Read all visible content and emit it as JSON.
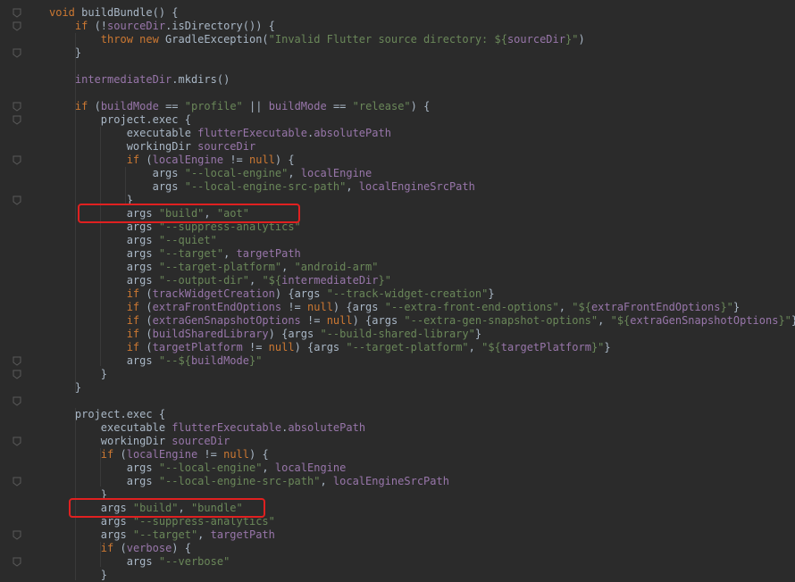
{
  "editor": {
    "language": "groovy",
    "colors": {
      "background": "#2b2b2b",
      "keyword": "#cc7832",
      "string": "#6a8759",
      "field": "#9876aa",
      "plain": "#a9b7c6",
      "highlight": "#e02020"
    },
    "highlights": [
      {
        "label": "args build aot",
        "line_index": 15
      },
      {
        "label": "args build bundle",
        "line_index": 37
      }
    ],
    "lines": [
      [
        [
          "kw",
          "void "
        ],
        [
          "plain",
          "buildBundle() {"
        ]
      ],
      [
        [
          "kw",
          "    if "
        ],
        [
          "plain",
          "(!"
        ],
        [
          "fld",
          "sourceDir"
        ],
        [
          "plain",
          ".isDirectory()) {"
        ]
      ],
      [
        [
          "kw",
          "        throw new "
        ],
        [
          "plain",
          "GradleException("
        ],
        [
          "str",
          "\"Invalid Flutter source directory: ${"
        ],
        [
          "fld",
          "sourceDir"
        ],
        [
          "str",
          "}\""
        ],
        [
          "plain",
          ")"
        ]
      ],
      [
        [
          "plain",
          "    }"
        ]
      ],
      [
        [
          "plain",
          ""
        ]
      ],
      [
        [
          "plain",
          "    "
        ],
        [
          "fld",
          "intermediateDir"
        ],
        [
          "plain",
          ".mkdirs()"
        ]
      ],
      [
        [
          "plain",
          ""
        ]
      ],
      [
        [
          "kw",
          "    if "
        ],
        [
          "plain",
          "("
        ],
        [
          "fld",
          "buildMode "
        ],
        [
          "plain",
          "== "
        ],
        [
          "str",
          "\"profile\" "
        ],
        [
          "plain",
          "|| "
        ],
        [
          "fld",
          "buildMode "
        ],
        [
          "plain",
          "== "
        ],
        [
          "str",
          "\"release\""
        ],
        [
          "plain",
          ") {"
        ]
      ],
      [
        [
          "plain",
          "        project.exec {"
        ]
      ],
      [
        [
          "plain",
          "            executable "
        ],
        [
          "fld",
          "flutterExecutable"
        ],
        [
          "plain",
          "."
        ],
        [
          "fld",
          "absolutePath"
        ]
      ],
      [
        [
          "plain",
          "            workingDir "
        ],
        [
          "fld",
          "sourceDir"
        ]
      ],
      [
        [
          "kw",
          "            if "
        ],
        [
          "plain",
          "("
        ],
        [
          "fld",
          "localEngine "
        ],
        [
          "plain",
          "!= "
        ],
        [
          "kw",
          "null"
        ],
        [
          "plain",
          ") {"
        ]
      ],
      [
        [
          "plain",
          "                args "
        ],
        [
          "str",
          "\"--local-engine\""
        ],
        [
          "plain",
          ", "
        ],
        [
          "fld",
          "localEngine"
        ]
      ],
      [
        [
          "plain",
          "                args "
        ],
        [
          "str",
          "\"--local-engine-src-path\""
        ],
        [
          "plain",
          ", "
        ],
        [
          "fld",
          "localEngineSrcPath"
        ]
      ],
      [
        [
          "plain",
          "            }"
        ]
      ],
      [
        [
          "plain",
          "            args "
        ],
        [
          "str",
          "\"build\""
        ],
        [
          "plain",
          ", "
        ],
        [
          "str",
          "\"aot\""
        ]
      ],
      [
        [
          "plain",
          "            args "
        ],
        [
          "str",
          "\"--suppress-analytics\""
        ]
      ],
      [
        [
          "plain",
          "            args "
        ],
        [
          "str",
          "\"--quiet\""
        ]
      ],
      [
        [
          "plain",
          "            args "
        ],
        [
          "str",
          "\"--target\""
        ],
        [
          "plain",
          ", "
        ],
        [
          "fld",
          "targetPath"
        ]
      ],
      [
        [
          "plain",
          "            args "
        ],
        [
          "str",
          "\"--target-platform\""
        ],
        [
          "plain",
          ", "
        ],
        [
          "str",
          "\"android-arm\""
        ]
      ],
      [
        [
          "plain",
          "            args "
        ],
        [
          "str",
          "\"--output-dir\""
        ],
        [
          "plain",
          ", "
        ],
        [
          "str",
          "\"${"
        ],
        [
          "fld",
          "intermediateDir"
        ],
        [
          "str",
          "}\""
        ]
      ],
      [
        [
          "kw",
          "            if "
        ],
        [
          "plain",
          "("
        ],
        [
          "fld",
          "trackWidgetCreation"
        ],
        [
          "plain",
          ") {args "
        ],
        [
          "str",
          "\"--track-widget-creation\""
        ],
        [
          "plain",
          "}"
        ]
      ],
      [
        [
          "kw",
          "            if "
        ],
        [
          "plain",
          "("
        ],
        [
          "fld",
          "extraFrontEndOptions "
        ],
        [
          "plain",
          "!= "
        ],
        [
          "kw",
          "null"
        ],
        [
          "plain",
          ") {args "
        ],
        [
          "str",
          "\"--extra-front-end-options\""
        ],
        [
          "plain",
          ", "
        ],
        [
          "str",
          "\"${"
        ],
        [
          "fld",
          "extraFrontEndOptions"
        ],
        [
          "str",
          "}\""
        ],
        [
          "plain",
          "}"
        ]
      ],
      [
        [
          "kw",
          "            if "
        ],
        [
          "plain",
          "("
        ],
        [
          "fld",
          "extraGenSnapshotOptions "
        ],
        [
          "plain",
          "!= "
        ],
        [
          "kw",
          "null"
        ],
        [
          "plain",
          ") {args "
        ],
        [
          "str",
          "\"--extra-gen-snapshot-options\""
        ],
        [
          "plain",
          ", "
        ],
        [
          "str",
          "\"${"
        ],
        [
          "fld",
          "extraGenSnapshotOptions"
        ],
        [
          "str",
          "}\""
        ],
        [
          "plain",
          "}"
        ]
      ],
      [
        [
          "kw",
          "            if "
        ],
        [
          "plain",
          "("
        ],
        [
          "fld",
          "buildSharedLibrary"
        ],
        [
          "plain",
          ") {args "
        ],
        [
          "str",
          "\"--build-shared-library\""
        ],
        [
          "plain",
          "}"
        ]
      ],
      [
        [
          "kw",
          "            if "
        ],
        [
          "plain",
          "("
        ],
        [
          "fld",
          "targetPlatform "
        ],
        [
          "plain",
          "!= "
        ],
        [
          "kw",
          "null"
        ],
        [
          "plain",
          ") {args "
        ],
        [
          "str",
          "\"--target-platform\""
        ],
        [
          "plain",
          ", "
        ],
        [
          "str",
          "\"${"
        ],
        [
          "fld",
          "targetPlatform"
        ],
        [
          "str",
          "}\""
        ],
        [
          "plain",
          "}"
        ]
      ],
      [
        [
          "plain",
          "            args "
        ],
        [
          "str",
          "\"--${"
        ],
        [
          "fld",
          "buildMode"
        ],
        [
          "str",
          "}\""
        ]
      ],
      [
        [
          "plain",
          "        }"
        ]
      ],
      [
        [
          "plain",
          "    }"
        ]
      ],
      [
        [
          "plain",
          ""
        ]
      ],
      [
        [
          "plain",
          "    project.exec {"
        ]
      ],
      [
        [
          "plain",
          "        executable "
        ],
        [
          "fld",
          "flutterExecutable"
        ],
        [
          "plain",
          "."
        ],
        [
          "fld",
          "absolutePath"
        ]
      ],
      [
        [
          "plain",
          "        workingDir "
        ],
        [
          "fld",
          "sourceDir"
        ]
      ],
      [
        [
          "kw",
          "        if "
        ],
        [
          "plain",
          "("
        ],
        [
          "fld",
          "localEngine "
        ],
        [
          "plain",
          "!= "
        ],
        [
          "kw",
          "null"
        ],
        [
          "plain",
          ") {"
        ]
      ],
      [
        [
          "plain",
          "            args "
        ],
        [
          "str",
          "\"--local-engine\""
        ],
        [
          "plain",
          ", "
        ],
        [
          "fld",
          "localEngine"
        ]
      ],
      [
        [
          "plain",
          "            args "
        ],
        [
          "str",
          "\"--local-engine-src-path\""
        ],
        [
          "plain",
          ", "
        ],
        [
          "fld",
          "localEngineSrcPath"
        ]
      ],
      [
        [
          "plain",
          "        }"
        ]
      ],
      [
        [
          "plain",
          "        args "
        ],
        [
          "str",
          "\"build\""
        ],
        [
          "plain",
          ", "
        ],
        [
          "str",
          "\"bundle\""
        ]
      ],
      [
        [
          "plain",
          "        args "
        ],
        [
          "str",
          "\"--suppress-analytics\""
        ]
      ],
      [
        [
          "plain",
          "        args "
        ],
        [
          "str",
          "\"--target\""
        ],
        [
          "plain",
          ", "
        ],
        [
          "fld",
          "targetPath"
        ]
      ],
      [
        [
          "kw",
          "        if "
        ],
        [
          "plain",
          "("
        ],
        [
          "fld",
          "verbose"
        ],
        [
          "plain",
          ") {"
        ]
      ],
      [
        [
          "plain",
          "            args "
        ],
        [
          "str",
          "\"--verbose\""
        ]
      ],
      [
        [
          "plain",
          "        }"
        ]
      ]
    ]
  }
}
